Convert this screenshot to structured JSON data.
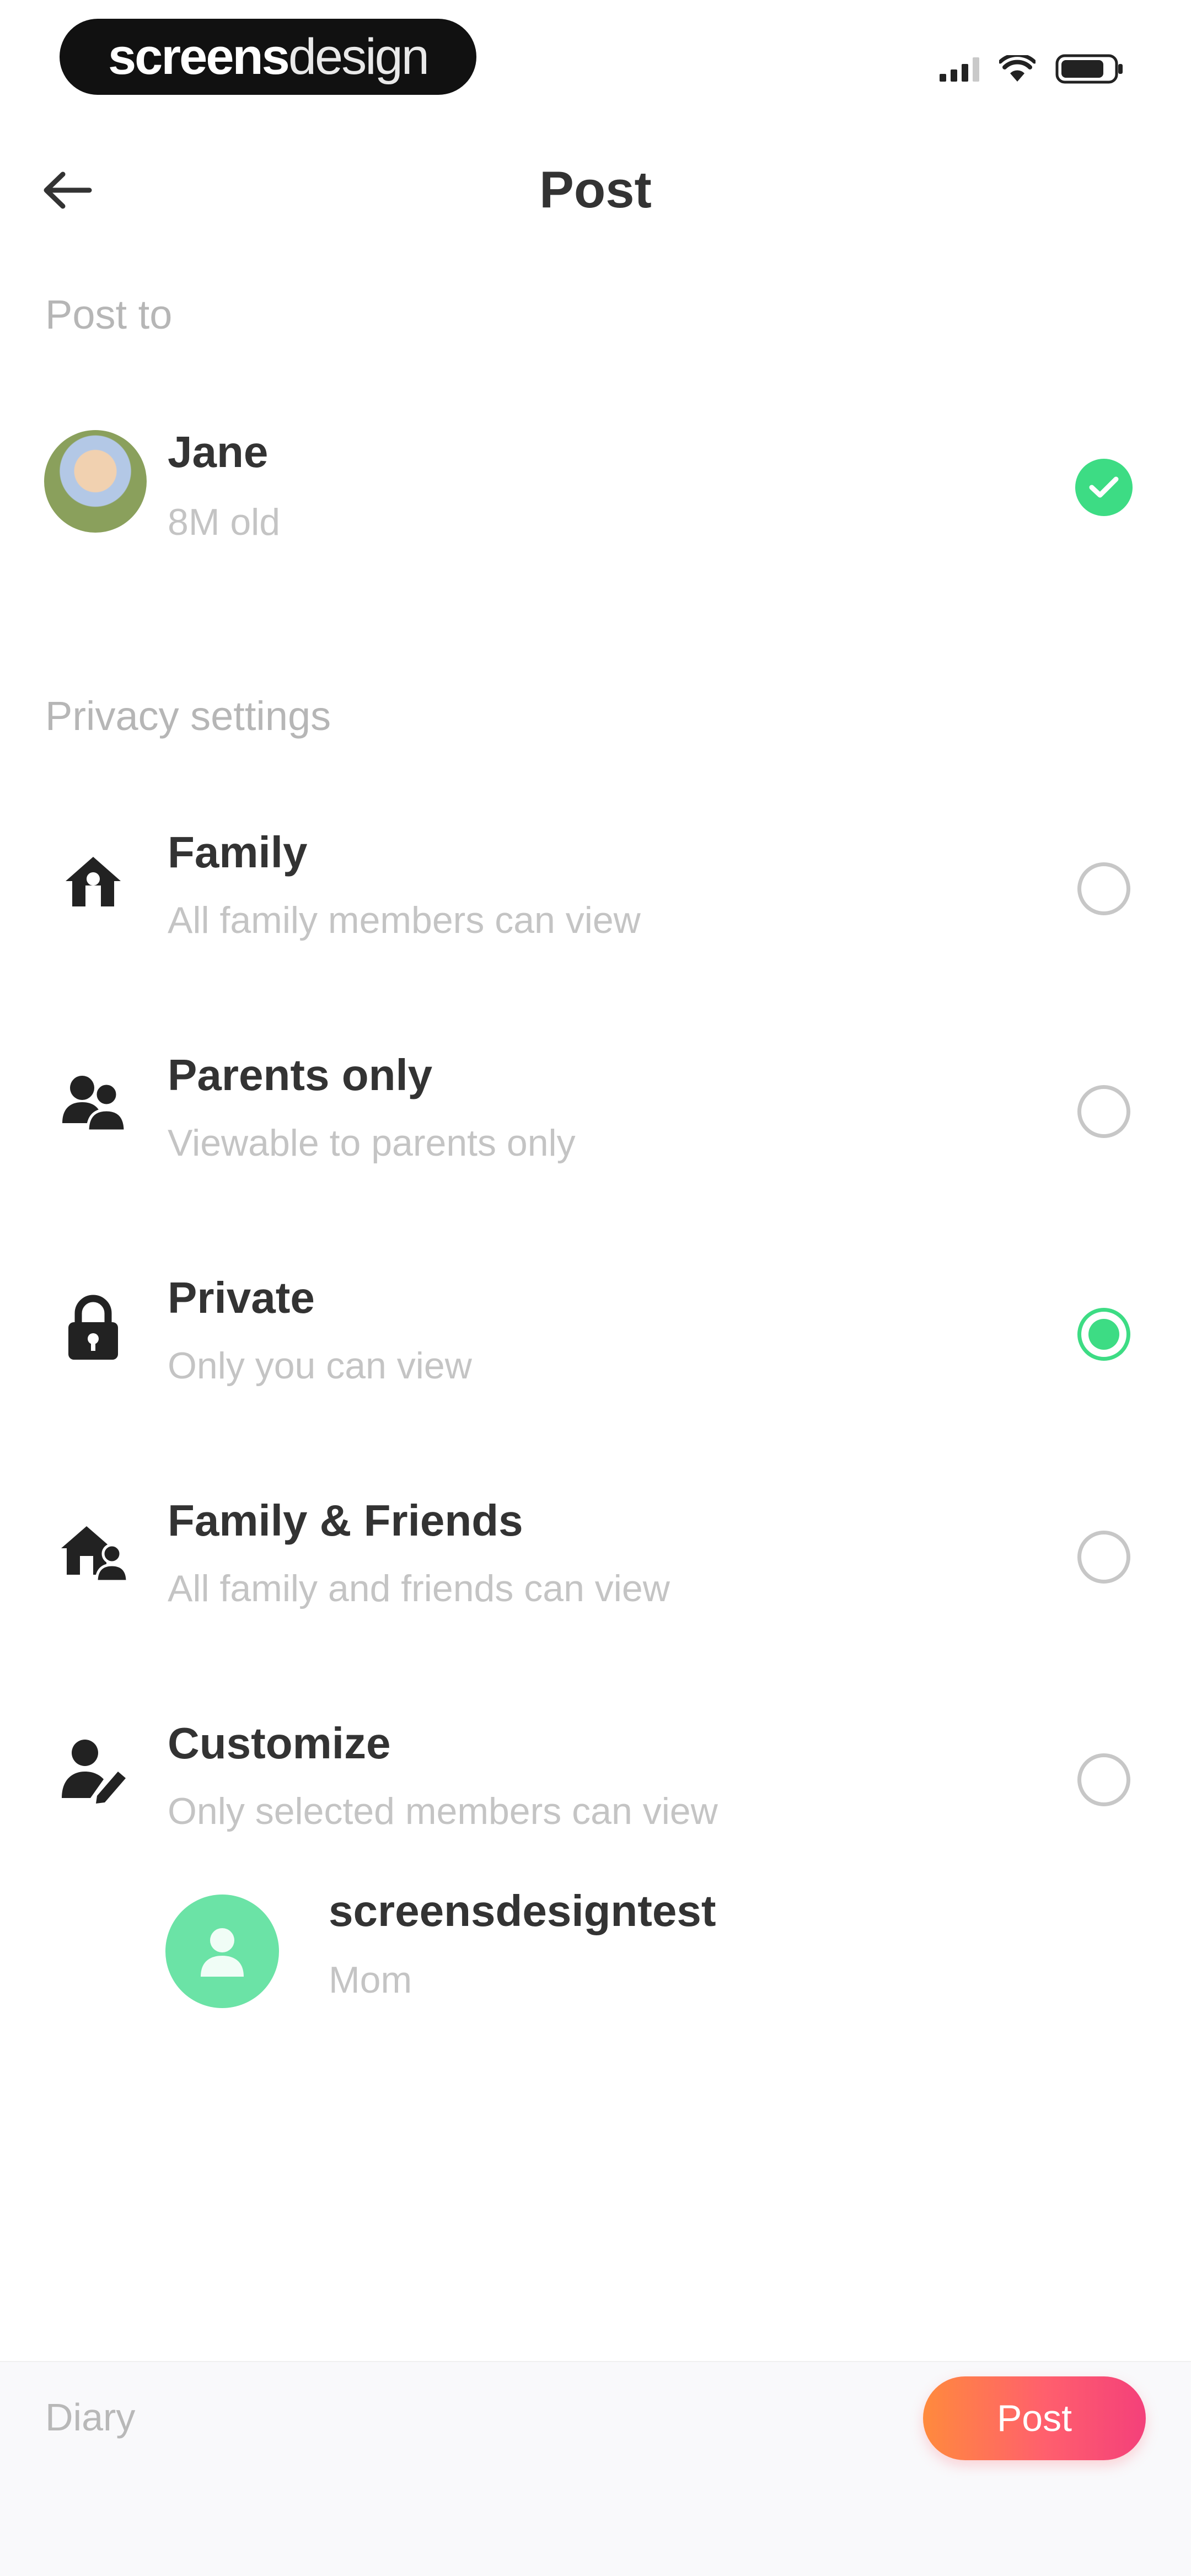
{
  "status_bar": {
    "brand_part1": "screens",
    "brand_part2": "design"
  },
  "header": {
    "title": "Post"
  },
  "post_to": {
    "label": "Post to",
    "account": {
      "name": "Jane",
      "age": "8M old",
      "selected": true
    }
  },
  "privacy": {
    "label": "Privacy settings",
    "options": [
      {
        "title": "Family",
        "subtitle": "All family members can view",
        "icon": "house-icon",
        "selected": false
      },
      {
        "title": "Parents only",
        "subtitle": "Viewable to parents only",
        "icon": "parents-icon",
        "selected": false
      },
      {
        "title": "Private",
        "subtitle": "Only you can view",
        "icon": "lock-icon",
        "selected": true
      },
      {
        "title": "Family & Friends",
        "subtitle": "All family and friends can view",
        "icon": "house-people-icon",
        "selected": false
      },
      {
        "title": "Customize",
        "subtitle": "Only selected members can view",
        "icon": "person-edit-icon",
        "selected": false
      }
    ],
    "member": {
      "name": "screensdesigntest",
      "role": "Mom"
    }
  },
  "bottom_bar": {
    "diary_label": "Diary",
    "post_label": "Post"
  },
  "colors": {
    "accent_green": "#3ddc84",
    "post_gradient_start": "#ff8a3d",
    "post_gradient_end": "#f4407a"
  }
}
